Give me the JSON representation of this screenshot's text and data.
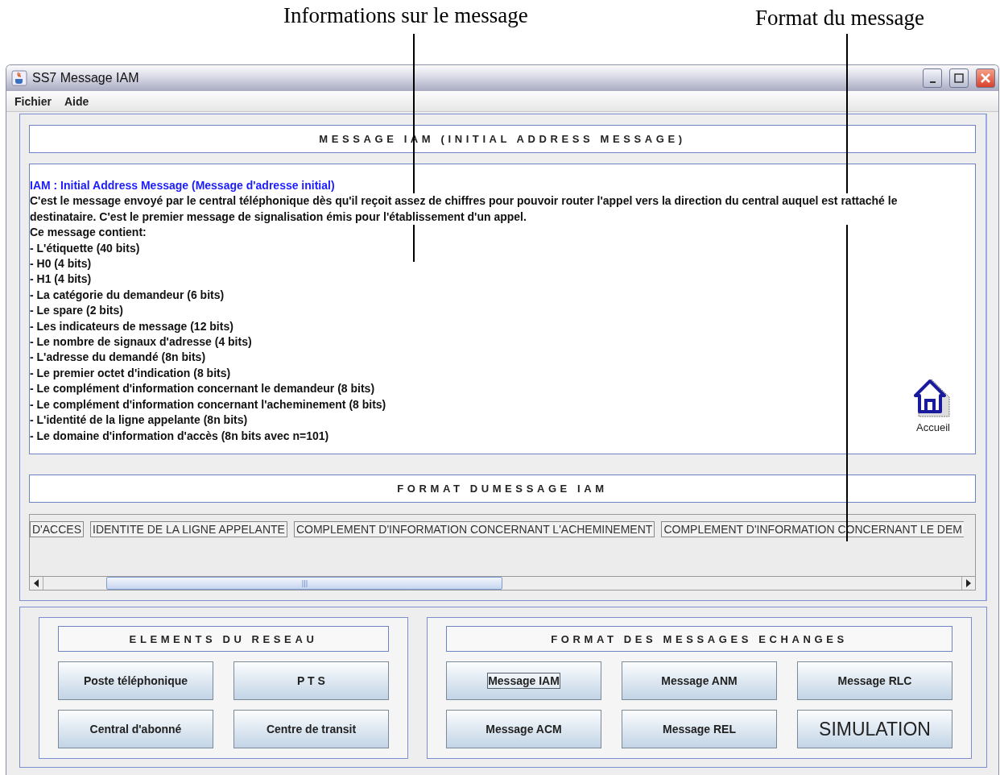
{
  "annotations": [
    {
      "text": "Informations sur le message"
    },
    {
      "text": "Format du message"
    }
  ],
  "window": {
    "title": "SS7 Message IAM"
  },
  "menu": [
    "Fichier",
    "Aide"
  ],
  "message_panel": {
    "title": "MESSAGE IAM (INITIAL ADDRESS MESSAGE)",
    "heading": "IAM : Initial Address Message (Message d'adresse initial)",
    "description": "C'est le message envoyé par le central téléphonique dès qu'il reçoit assez de chiffres pour pouvoir router l'appel vers la direction du central auquel est rattaché le destinataire. C'est le premier message de signalisation émis pour l'établissement d'un appel.",
    "intro": "Ce message contient:",
    "items": [
      "- L'étiquette (40 bits)",
      "- H0 (4 bits)",
      "- H1 (4 bits)",
      "- La catégorie du demandeur (6 bits)",
      "- Le spare (2 bits)",
      "- Les indicateurs de message (12 bits)",
      "- Le nombre de signaux d'adresse (4 bits)",
      "- L'adresse du demandé (8n bits)",
      "- Le premier octet d'indication (8 bits)",
      "- Le complément d'information concernant le demandeur (8 bits)",
      "- Le complément d'information concernant l'acheminement (8 bits)",
      "- L'identité de la ligne appelante (8n bits)",
      "- Le domaine d'information d'accès (8n bits avec n=101)"
    ],
    "home_label": "Accueil"
  },
  "format_panel": {
    "title": "FORMAT DUMESSAGE IAM",
    "fields": [
      "D'ACCES",
      "IDENTITE DE LA LIGNE APPELANTE",
      "COMPLEMENT D'INFORMATION CONCERNANT L'ACHEMINEMENT",
      "COMPLEMENT D'INFORMATION CONCERNANT LE DEM"
    ]
  },
  "network_elements": {
    "title": "ELEMENTS DU RESEAU",
    "buttons": [
      {
        "label": "Poste téléphonique",
        "kind": "normal",
        "focused": false
      },
      {
        "label": "P T S",
        "kind": "normal",
        "focused": false
      },
      {
        "label": "Central d'abonné",
        "kind": "normal",
        "focused": false
      },
      {
        "label": "Centre de transit",
        "kind": "normal",
        "focused": false
      }
    ]
  },
  "exchanged_messages": {
    "title": "FORMAT DES MESSAGES ECHANGES",
    "buttons": [
      {
        "label": "Message IAM",
        "kind": "normal",
        "focused": true
      },
      {
        "label": "Message ANM",
        "kind": "normal",
        "focused": false
      },
      {
        "label": "Message RLC",
        "kind": "normal",
        "focused": false
      },
      {
        "label": "Message ACM",
        "kind": "normal",
        "focused": false
      },
      {
        "label": "Message REL",
        "kind": "normal",
        "focused": false
      },
      {
        "label": "SIMULATION",
        "kind": "large",
        "focused": false
      }
    ]
  }
}
